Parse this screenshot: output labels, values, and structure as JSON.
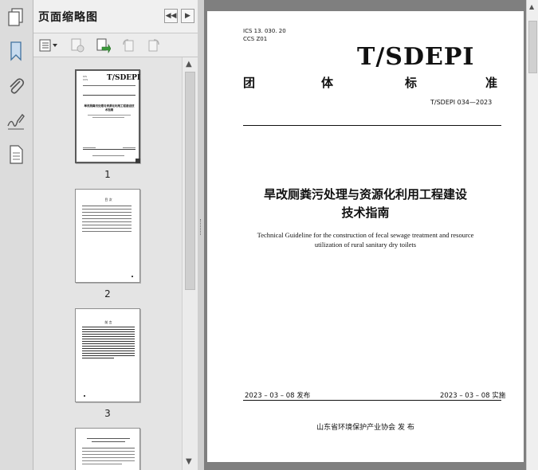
{
  "panel": {
    "title": "页面缩略图",
    "thumbnails": [
      {
        "label": "1"
      },
      {
        "label": "2"
      },
      {
        "label": "3"
      }
    ]
  },
  "document": {
    "ics": "ICS  13. 030. 20",
    "ccs": "CCS  Z01",
    "logo_text": "T/SDEPI",
    "standard_type_chars": [
      "团",
      "体",
      "标",
      "准"
    ],
    "standard_number": "T/SDEPI 034—2023",
    "title_cn_line1": "旱改厕粪污处理与资源化利用工程建设",
    "title_cn_line2": "技术指南",
    "title_en_line1": "Technical Guideline for the construction of fecal sewage treatment and resource",
    "title_en_line2": "utilization of rural sanitary dry toilets",
    "publish_date": "2023 – 03 – 08 发布",
    "implement_date": "2023 – 03 – 08 实施",
    "publisher": "山东省环境保护产业协会       发  布"
  },
  "thumb_p1": {
    "logo": "T/SDEPI",
    "title": "旱改厕粪污处理与资源化利用工程建设技术指南"
  },
  "thumb_p2": {
    "heading": "目  次"
  },
  "thumb_p3": {
    "heading": "前  言"
  }
}
